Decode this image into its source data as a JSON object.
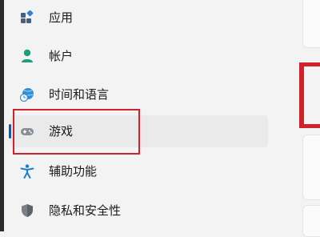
{
  "sidebar": {
    "items": [
      {
        "label": "应用",
        "icon": "apps-icon"
      },
      {
        "label": "帐户",
        "icon": "account-icon"
      },
      {
        "label": "时间和语言",
        "icon": "globe-clock-icon"
      },
      {
        "label": "游戏",
        "icon": "gamepad-icon",
        "selected": true
      },
      {
        "label": "辅助功能",
        "icon": "accessibility-icon"
      },
      {
        "label": "隐私和安全性",
        "icon": "shield-icon"
      }
    ]
  },
  "colors": {
    "accent": "#005fb8",
    "annotation_red": "#d0222a",
    "selected_bg": "#eaeaea",
    "background": "#f3f3f3"
  }
}
